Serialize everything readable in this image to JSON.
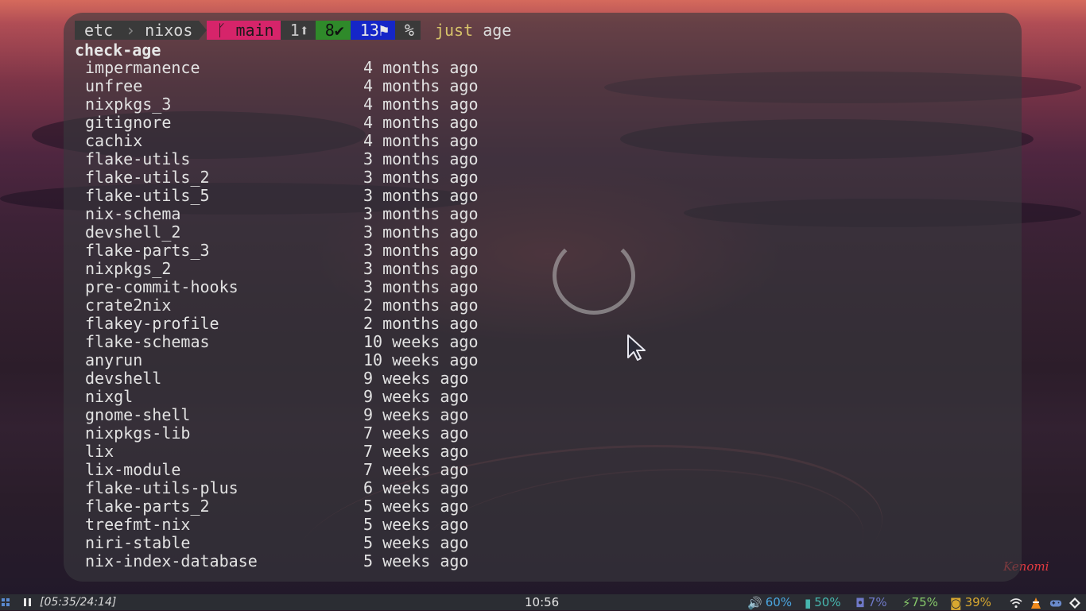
{
  "prompt": {
    "dir_parent": "etc",
    "dir_current": "nixos",
    "branch_icon": "ᚴ",
    "branch": "main",
    "ahead": "1⬆",
    "clean": "8✔",
    "flags": "13⚑",
    "percent": "%",
    "command_keyword": "just",
    "command_arg": "age"
  },
  "output": {
    "heading": "check-age",
    "rows": [
      {
        "name": "impermanence",
        "age": "4 months ago"
      },
      {
        "name": "unfree",
        "age": "4 months ago"
      },
      {
        "name": "nixpkgs_3",
        "age": "4 months ago"
      },
      {
        "name": "gitignore",
        "age": "4 months ago"
      },
      {
        "name": "cachix",
        "age": "4 months ago"
      },
      {
        "name": "flake-utils",
        "age": "3 months ago"
      },
      {
        "name": "flake-utils_2",
        "age": "3 months ago"
      },
      {
        "name": "flake-utils_5",
        "age": "3 months ago"
      },
      {
        "name": "nix-schema",
        "age": "3 months ago"
      },
      {
        "name": "devshell_2",
        "age": "3 months ago"
      },
      {
        "name": "flake-parts_3",
        "age": "3 months ago"
      },
      {
        "name": "nixpkgs_2",
        "age": "3 months ago"
      },
      {
        "name": "pre-commit-hooks",
        "age": "3 months ago"
      },
      {
        "name": "crate2nix",
        "age": "2 months ago"
      },
      {
        "name": "flakey-profile",
        "age": "2 months ago"
      },
      {
        "name": "flake-schemas",
        "age": "10 weeks ago"
      },
      {
        "name": "anyrun",
        "age": "10 weeks ago"
      },
      {
        "name": "devshell",
        "age": "9 weeks ago"
      },
      {
        "name": "nixgl",
        "age": "9 weeks ago"
      },
      {
        "name": "gnome-shell",
        "age": "9 weeks ago"
      },
      {
        "name": "nixpkgs-lib",
        "age": "7 weeks ago"
      },
      {
        "name": "lix",
        "age": "7 weeks ago"
      },
      {
        "name": "lix-module",
        "age": "7 weeks ago"
      },
      {
        "name": "flake-utils-plus",
        "age": "6 weeks ago"
      },
      {
        "name": "flake-parts_2",
        "age": "5 weeks ago"
      },
      {
        "name": "treefmt-nix",
        "age": "5 weeks ago"
      },
      {
        "name": "niri-stable",
        "age": "5 weeks ago"
      },
      {
        "name": "nix-index-database",
        "age": "5 weeks ago"
      }
    ]
  },
  "taskbar": {
    "running_timer": "[05:35/24:14]",
    "clock": "10:56",
    "volume": "60%",
    "memory": "50%",
    "cpu": "7%",
    "battery": "75%",
    "disk": "39%",
    "icons": [
      "start-menu-icon",
      "pause-icon",
      "volume-icon",
      "memory-icon",
      "cpu-icon",
      "battery-icon",
      "disk-icon",
      "wifi-icon",
      "vlc-icon",
      "gamepad-icon",
      "diamond-icon"
    ]
  },
  "wallpaper": {
    "signature": "Kenomi"
  },
  "colors": {
    "branch_bg": "#d6246a",
    "clean_bg": "#2f8a2a",
    "flags_bg": "#1526c8",
    "command_keyword": "#d7c36a",
    "volume": "#4aa6e0",
    "memory": "#47b8b0",
    "cpu": "#6f79c8",
    "battery": "#86c86a",
    "disk": "#d8a830"
  }
}
